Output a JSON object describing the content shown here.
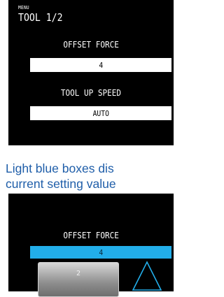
{
  "screen1": {
    "menu_label": "MENU",
    "title": "TOOL 1/2",
    "field1": {
      "label": "OFFSET FORCE",
      "value": "4"
    },
    "field2": {
      "label": "TOOL UP SPEED",
      "value": "AUTO"
    }
  },
  "caption": {
    "line1": "Light blue boxes dis",
    "line2": "current setting value"
  },
  "screen2": {
    "label": "OFFSET FORCE",
    "value": "4",
    "key_value": "2",
    "up_icon": "triangle-up-icon"
  },
  "colors": {
    "lcd_background": "#000000",
    "highlight_blue": "#22aeea",
    "caption_text": "#1f5ea9"
  }
}
